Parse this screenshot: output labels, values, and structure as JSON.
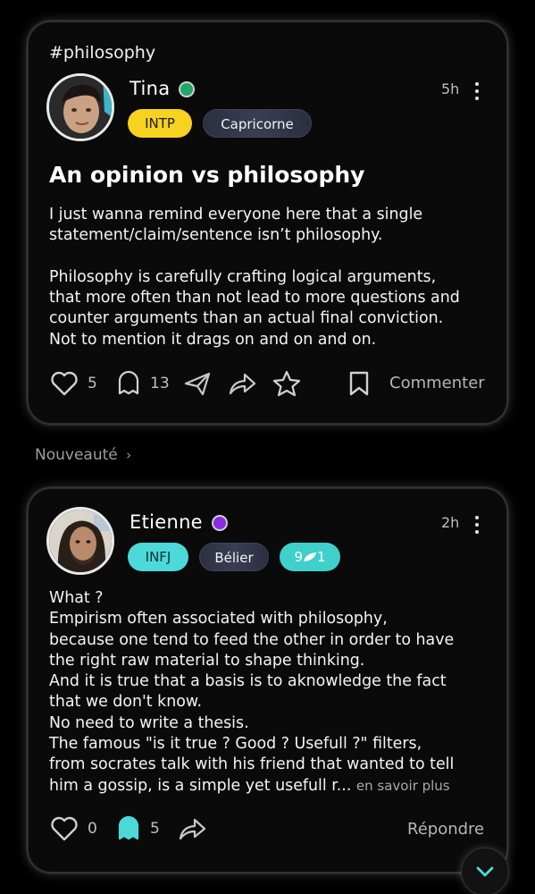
{
  "feed": {
    "section_label": "Nouveauté",
    "posts": [
      {
        "hashtag": "#philosophy",
        "author": "Tina",
        "time": "5h",
        "tags": [
          "INTP",
          "Capricorne"
        ],
        "status_color": "#1fa86a",
        "title": "An opinion vs philosophy",
        "body_lines": [
          "I just wanna remind everyone here that a single",
          "statement/claim/sentence isn’t philosophy.",
          "",
          "Philosophy is carefully crafting logical arguments,",
          "that more often than not lead to more questions and",
          "counter arguments than an actual final conviction.",
          "Not to mention it drags on and on and on."
        ],
        "likes": "5",
        "comments": "13",
        "reply_label": "Commenter"
      },
      {
        "author": "Etienne",
        "time": "2h",
        "tags": [
          "INFJ",
          "Bélier"
        ],
        "level_badge": "9",
        "level_suffix": "1",
        "status_color": "#8a2be2",
        "body_lines": [
          "What ?",
          "Empirism often associated with philosophy,",
          "because one tend to feed the other in order to have",
          "the right raw material to shape thinking.",
          "And it is true that a basis is to aknowledge the fact",
          "that we don't know.",
          "No need to write a thesis.",
          "The famous \"is it true ? Good ? Usefull ?\" filters,",
          "from socrates talk with his friend that wanted to tell",
          "him a gossip, is a simple yet usefull r..."
        ],
        "see_more": "en savoir plus",
        "likes": "0",
        "comments": "5",
        "reply_label": "Répondre"
      }
    ]
  },
  "colors": {
    "accent_teal": "#4dd9d9",
    "accent_yellow": "#f7d21e",
    "background": "#000000"
  },
  "icons": [
    "heart-icon",
    "ghost-comment-icon",
    "send-icon",
    "share-icon",
    "star-icon",
    "bookmark-icon",
    "more-icon",
    "chevron-down-icon"
  ]
}
